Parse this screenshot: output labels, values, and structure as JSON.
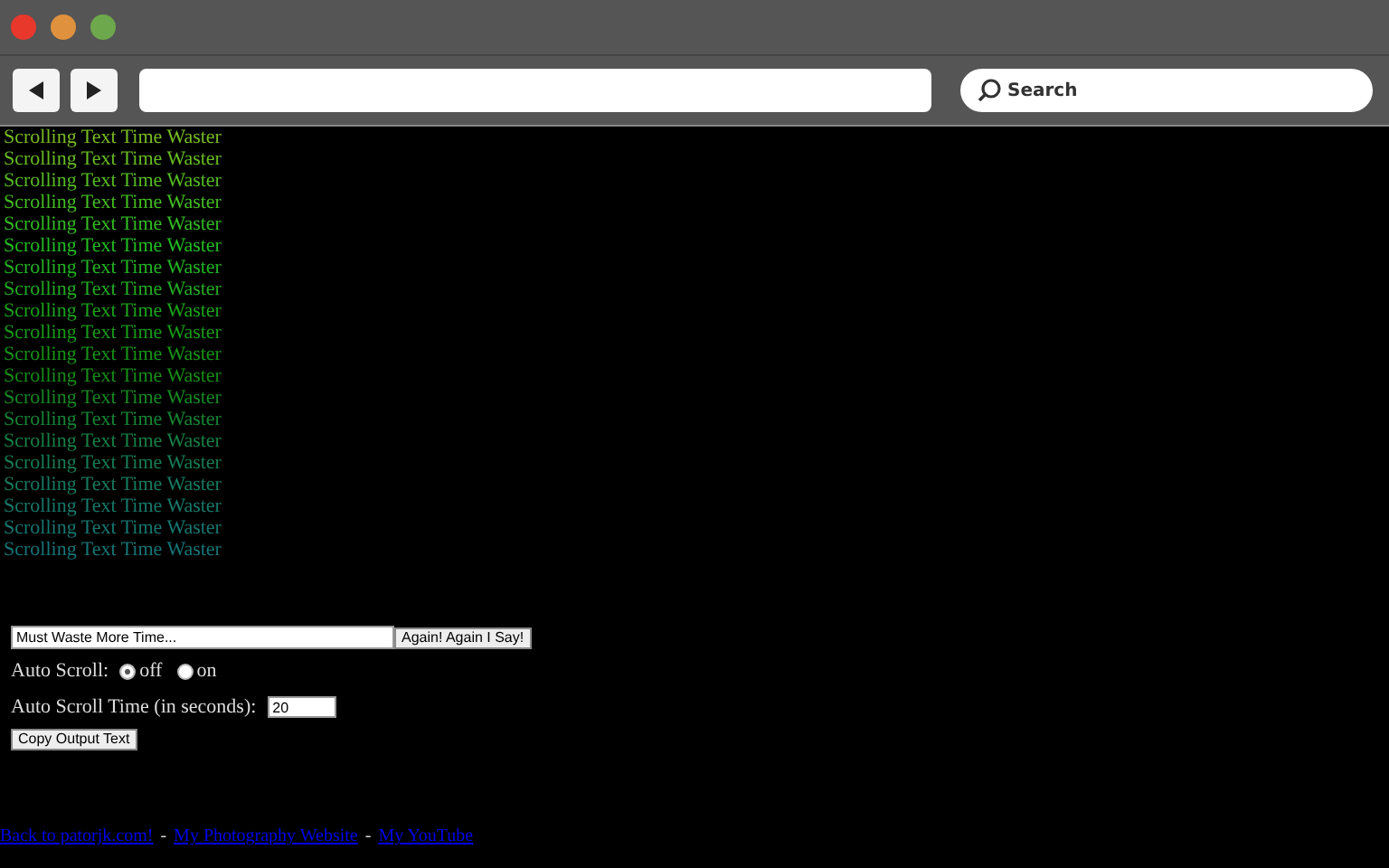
{
  "browser": {
    "search": {
      "placeholder": "Search"
    }
  },
  "lines": [
    {
      "text": "Scrolling Text Time Waster",
      "color": "#77bb22"
    },
    {
      "text": "Scrolling Text Time Waster",
      "color": "#66bb22"
    },
    {
      "text": "Scrolling Text Time Waster",
      "color": "#55bb22"
    },
    {
      "text": "Scrolling Text Time Waster",
      "color": "#44bb22"
    },
    {
      "text": "Scrolling Text Time Waster",
      "color": "#33bb22"
    },
    {
      "text": "Scrolling Text Time Waster",
      "color": "#22bb22"
    },
    {
      "text": "Scrolling Text Time Waster",
      "color": "#22b222"
    },
    {
      "text": "Scrolling Text Time Waster",
      "color": "#22aa22"
    },
    {
      "text": "Scrolling Text Time Waster",
      "color": "#1ba31b"
    },
    {
      "text": "Scrolling Text Time Waster",
      "color": "#189a18"
    },
    {
      "text": "Scrolling Text Time Waster",
      "color": "#179317"
    },
    {
      "text": "Scrolling Text Time Waster",
      "color": "#168c16"
    },
    {
      "text": "Scrolling Text Time Waster",
      "color": "#168822"
    },
    {
      "text": "Scrolling Text Time Waster",
      "color": "#168433"
    },
    {
      "text": "Scrolling Text Time Waster",
      "color": "#168044"
    },
    {
      "text": "Scrolling Text Time Waster",
      "color": "#167c55"
    },
    {
      "text": "Scrolling Text Time Waster",
      "color": "#167a60"
    },
    {
      "text": "Scrolling Text Time Waster",
      "color": "#16786a"
    },
    {
      "text": "Scrolling Text Time Waster",
      "color": "#167670"
    },
    {
      "text": "Scrolling Text Time Waster",
      "color": "#167477"
    }
  ],
  "input": {
    "value": "Must Waste More Time...",
    "button": "Again! Again I Say!"
  },
  "auto_scroll": {
    "label": "Auto Scroll:",
    "options": [
      {
        "label": "off",
        "selected": true
      },
      {
        "label": "on",
        "selected": false
      }
    ]
  },
  "auto_scroll_time": {
    "label": "Auto Scroll Time (in seconds):",
    "value": "20"
  },
  "copy_button": "Copy Output Text",
  "footer": [
    {
      "kind": "link",
      "text": "Back to patorjk.com!"
    },
    {
      "kind": "separator",
      "text": "-"
    },
    {
      "kind": "link",
      "text": "My Photography Website"
    },
    {
      "kind": "separator",
      "text": "-"
    },
    {
      "kind": "link",
      "text": "My YouTube"
    }
  ]
}
